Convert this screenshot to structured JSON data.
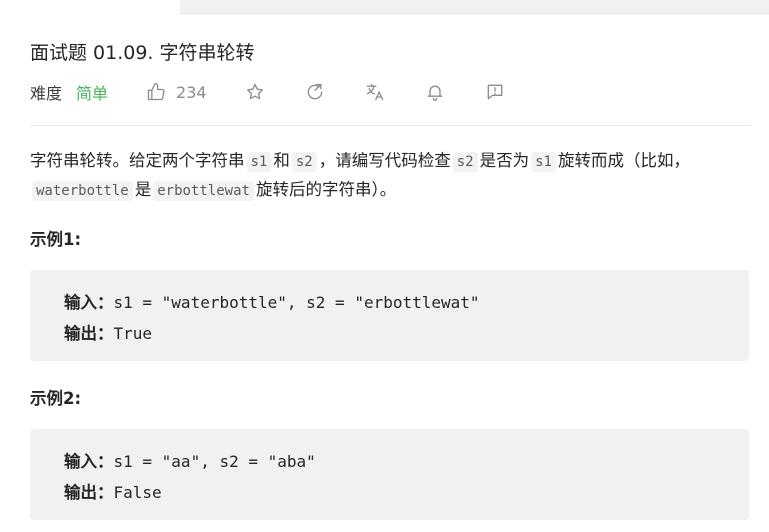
{
  "problem": {
    "title": "面试题 01.09. 字符串轮转",
    "difficulty_label": "难度",
    "difficulty": "简单",
    "like_count": "234",
    "description": {
      "p1": "字符串轮转。给定两个字符串",
      "code_s1": "s1",
      "p2": "和",
      "code_s2": "s2",
      "p3": "，请编写代码检查",
      "code_s2b": "s2",
      "p4": "是否为",
      "code_s1b": "s1",
      "p5": "旋转而成（比如，",
      "code_waterbottle": "waterbottle",
      "p6": "是",
      "code_erbottlewat": "erbottlewat",
      "p7": "旋转后的字符串）。"
    }
  },
  "icons": {
    "like": "thumbs-up-icon",
    "star": "star-icon",
    "share": "share-icon",
    "translate": "translate-icon",
    "notify": "bell-icon",
    "feedback": "feedback-icon"
  },
  "examples": [
    {
      "heading": "示例1:",
      "input_label": "输入：",
      "input_value": "s1 = \"waterbottle\", s2 = \"erbottlewat\"",
      "output_label": "输出：",
      "output_value": "True"
    },
    {
      "heading": "示例2:",
      "input_label": "输入：",
      "input_value": "s1 = \"aa\", s2 = \"aba\"",
      "output_label": "输出：",
      "output_value": "False"
    }
  ],
  "colors": {
    "difficulty_easy": "#45b35a",
    "code_bg": "#f2f3f4",
    "example_bg": "#f0f1f3",
    "icon_gray": "#8c8c8c"
  }
}
